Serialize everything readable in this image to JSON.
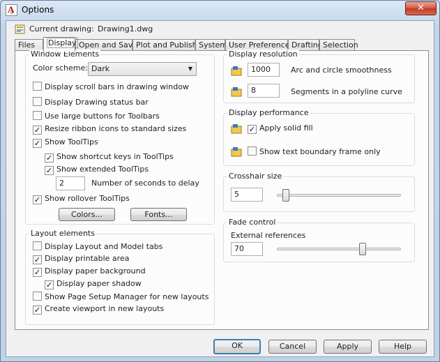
{
  "window": {
    "title": "Options",
    "close_label": "✕"
  },
  "header": {
    "current_drawing_label": "Current drawing:",
    "current_drawing_value": "Drawing1.dwg"
  },
  "tabs": [
    {
      "label": "Files",
      "active": false
    },
    {
      "label": "Display",
      "active": true
    },
    {
      "label": "Open and Save",
      "active": false
    },
    {
      "label": "Plot and Publish",
      "active": false
    },
    {
      "label": "System",
      "active": false
    },
    {
      "label": "User Preferences",
      "active": false
    },
    {
      "label": "Drafting",
      "active": false
    },
    {
      "label": "Selection",
      "active": false
    }
  ],
  "window_elements": {
    "title": "Window Elements",
    "color_scheme_label": "Color scheme:",
    "color_scheme_value": "Dark",
    "options": [
      {
        "label": "Display scroll bars in drawing window",
        "checked": false
      },
      {
        "label": "Display Drawing status bar",
        "checked": false
      },
      {
        "label": "Use large buttons for Toolbars",
        "checked": false
      },
      {
        "label": "Resize ribbon icons to standard sizes",
        "checked": true
      },
      {
        "label": "Show ToolTips",
        "checked": true
      },
      {
        "label": "Show shortcut keys in ToolTips",
        "checked": true
      },
      {
        "label": "Show extended ToolTips",
        "checked": true
      },
      {
        "label": "Show rollover ToolTips",
        "checked": true
      }
    ],
    "delay_value": "2",
    "delay_label": "Number of seconds to delay",
    "colors_button": "Colors...",
    "fonts_button": "Fonts..."
  },
  "layout_elements": {
    "title": "Layout elements",
    "options": [
      {
        "label": "Display Layout and Model tabs",
        "checked": false
      },
      {
        "label": "Display printable area",
        "checked": true
      },
      {
        "label": "Display paper background",
        "checked": true
      },
      {
        "label": "Display paper shadow",
        "checked": true
      },
      {
        "label": "Show Page Setup Manager for new layouts",
        "checked": false
      },
      {
        "label": "Create viewport in new layouts",
        "checked": true
      }
    ]
  },
  "display_resolution": {
    "title": "Display resolution",
    "arc_value": "1000",
    "arc_label": "Arc and circle smoothness",
    "segments_value": "8",
    "segments_label": "Segments in a polyline curve"
  },
  "display_performance": {
    "title": "Display performance",
    "options": [
      {
        "label": "Apply solid fill",
        "checked": true
      },
      {
        "label": "Show text boundary frame only",
        "checked": false
      }
    ]
  },
  "crosshair": {
    "title": "Crosshair size",
    "value": "5",
    "level_fraction": 0.05
  },
  "fade": {
    "title": "Fade control",
    "xref_label": "External references",
    "value": "70",
    "level_fraction": 0.7
  },
  "footer": {
    "ok": "OK",
    "cancel": "Cancel",
    "apply": "Apply",
    "help": "Help"
  },
  "colors": {
    "accent": "#3c7fb1",
    "close_button": "#c23a22",
    "panel_bg": "#fcfcfc"
  },
  "icons": {
    "app": "autocad-lt-icon",
    "drawing": "drawing-file-icon",
    "setting": "drawing-setting-icon"
  }
}
